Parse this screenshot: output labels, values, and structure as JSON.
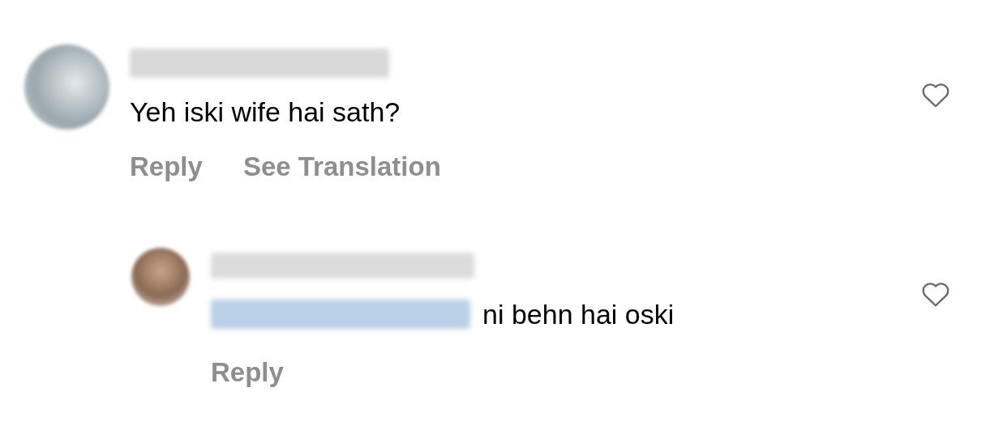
{
  "comments": [
    {
      "text": "Yeh iski wife hai sath?",
      "liked": false,
      "actions": [
        "Reply",
        "See Translation"
      ],
      "replies": [
        {
          "text": "ni behn hai oski",
          "liked": false,
          "actions": [
            "Reply"
          ]
        }
      ]
    }
  ]
}
